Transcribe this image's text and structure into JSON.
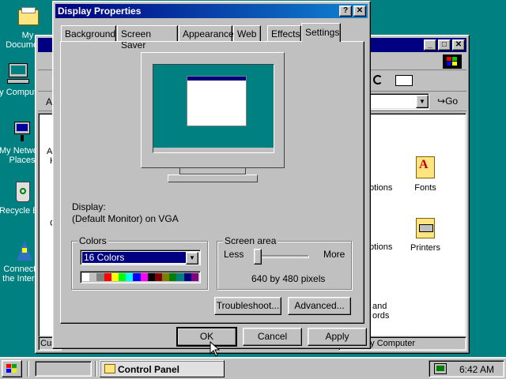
{
  "desktop": {
    "icons": [
      {
        "label": "My Documents",
        "icon": "folder-icon"
      },
      {
        "label": "My Computer",
        "icon": "computer-icon"
      },
      {
        "label": "My Network Places",
        "icon": "network-icon"
      },
      {
        "label": "Recycle Bin",
        "icon": "recycle-bin-icon"
      },
      {
        "label": "Connect to the Internet",
        "icon": "internet-connect-icon"
      }
    ]
  },
  "control_panel": {
    "visible_labels": {
      "addr_fragment": "A",
      "left_fragment_1": "Ac",
      "left_fragment_2": "H",
      "left_fragment_3": "C",
      "status_left": "Cus",
      "status_right": "My Computer",
      "go": "Go"
    },
    "items": [
      {
        "label": "Fonts",
        "icon": "fonts-icon"
      },
      {
        "label": "Printers",
        "icon": "printers-icon"
      }
    ],
    "partial_items": [
      "ptions",
      "ptions",
      "and",
      "ords"
    ]
  },
  "dialog": {
    "title": "Display Properties",
    "tabs": [
      "Background",
      "Screen Saver",
      "Appearance",
      "Web",
      "Effects",
      "Settings"
    ],
    "active_tab": "Settings",
    "display_label": "Display:",
    "display_value": "(Default Monitor) on VGA",
    "colors": {
      "group_label": "Colors",
      "selected": "16 Colors",
      "palette": [
        "#ffffff",
        "#c0c0c0",
        "#808080",
        "#ff0000",
        "#ffff00",
        "#00ff00",
        "#00ffff",
        "#0000ff",
        "#ff00ff",
        "#000000",
        "#800000",
        "#808000",
        "#008000",
        "#008080",
        "#000080",
        "#800080"
      ]
    },
    "screen_area": {
      "group_label": "Screen area",
      "less": "Less",
      "more": "More",
      "value_text": "640 by 480 pixels",
      "slider_level": 0
    },
    "buttons": {
      "troubleshoot": "Troubleshoot...",
      "advanced": "Advanced...",
      "ok": "OK",
      "cancel": "Cancel",
      "apply": "Apply",
      "help": "?",
      "close": "✕"
    }
  },
  "taskbar": {
    "task_label": "Control Panel",
    "clock": "6:42 AM"
  }
}
